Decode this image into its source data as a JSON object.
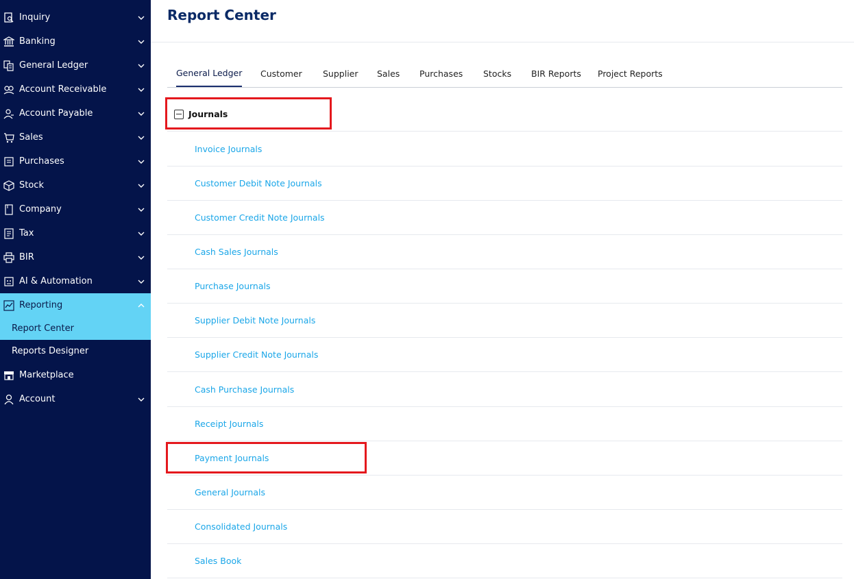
{
  "sidebar": {
    "items": [
      {
        "label": "Inquiry",
        "icon": "inquiry-icon"
      },
      {
        "label": "Banking",
        "icon": "bank-icon"
      },
      {
        "label": "General Ledger",
        "icon": "ledger-icon"
      },
      {
        "label": "Account Receivable",
        "icon": "receivable-icon"
      },
      {
        "label": "Account Payable",
        "icon": "payable-icon"
      },
      {
        "label": "Sales",
        "icon": "cart-icon"
      },
      {
        "label": "Purchases",
        "icon": "purchases-icon"
      },
      {
        "label": "Stock",
        "icon": "box-icon"
      },
      {
        "label": "Company",
        "icon": "building-icon"
      },
      {
        "label": "Tax",
        "icon": "tax-icon"
      },
      {
        "label": "BIR",
        "icon": "printer-icon"
      },
      {
        "label": "AI & Automation",
        "icon": "robot-icon"
      },
      {
        "label": "Reporting",
        "icon": "chart-icon"
      }
    ],
    "reporting_sub": [
      {
        "label": "Report Center"
      },
      {
        "label": "Reports Designer"
      }
    ],
    "bottom_items": [
      {
        "label": "Marketplace",
        "icon": "store-icon"
      },
      {
        "label": "Account",
        "icon": "user-icon"
      }
    ],
    "active_color": "#63d3f5",
    "background": "#04144a"
  },
  "main": {
    "title": "Report Center",
    "tabs": [
      {
        "label": "General Ledger"
      },
      {
        "label": "Customer"
      },
      {
        "label": "Supplier"
      },
      {
        "label": "Sales"
      },
      {
        "label": "Purchases"
      },
      {
        "label": "Stocks"
      },
      {
        "label": "BIR Reports"
      },
      {
        "label": "Project Reports"
      }
    ],
    "active_tab": "General Ledger",
    "section": {
      "title": "Journals",
      "reports": [
        {
          "label": "Invoice Journals"
        },
        {
          "label": "Customer Debit Note Journals"
        },
        {
          "label": "Customer Credit Note Journals"
        },
        {
          "label": "Cash Sales Journals"
        },
        {
          "label": "Purchase Journals"
        },
        {
          "label": "Supplier Debit Note Journals"
        },
        {
          "label": "Supplier Credit Note Journals"
        },
        {
          "label": "Cash Purchase Journals"
        },
        {
          "label": "Receipt Journals"
        },
        {
          "label": "Payment Journals"
        },
        {
          "label": "General Journals"
        },
        {
          "label": "Consolidated Journals"
        },
        {
          "label": "Sales Book"
        }
      ]
    },
    "link_color": "#1aa6e8",
    "highlight_color": "#e4181d"
  }
}
